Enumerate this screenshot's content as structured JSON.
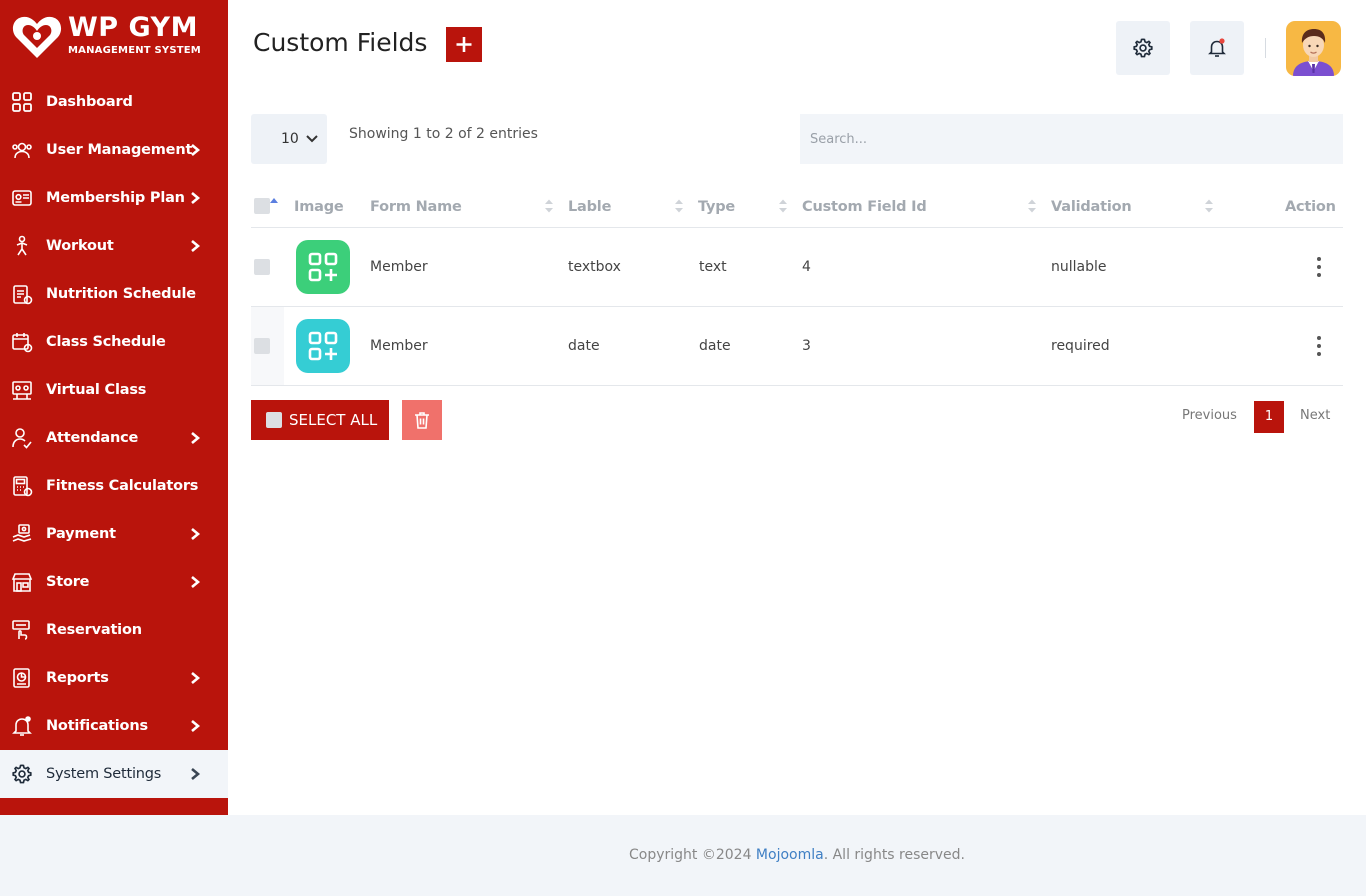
{
  "brand": {
    "title": "WP GYM",
    "subtitle": "MANAGEMENT SYSTEM",
    "color": "#b9140c"
  },
  "sidebar": {
    "items": [
      {
        "label": "Dashboard",
        "icon": "dashboard-icon",
        "has_submenu": false
      },
      {
        "label": "User Management",
        "icon": "users-icon",
        "has_submenu": true
      },
      {
        "label": "Membership Plan",
        "icon": "membership-card-icon",
        "has_submenu": true
      },
      {
        "label": "Workout",
        "icon": "workout-icon",
        "has_submenu": true
      },
      {
        "label": "Nutrition Schedule",
        "icon": "nutrition-icon",
        "has_submenu": false
      },
      {
        "label": "Class Schedule",
        "icon": "calendar-icon",
        "has_submenu": false
      },
      {
        "label": "Virtual Class",
        "icon": "virtual-class-icon",
        "has_submenu": false
      },
      {
        "label": "Attendance",
        "icon": "attendance-icon",
        "has_submenu": true
      },
      {
        "label": "Fitness Calculators",
        "icon": "calculator-icon",
        "has_submenu": false
      },
      {
        "label": "Payment",
        "icon": "payment-icon",
        "has_submenu": true
      },
      {
        "label": "Store",
        "icon": "store-icon",
        "has_submenu": true
      },
      {
        "label": "Reservation",
        "icon": "reservation-icon",
        "has_submenu": false
      },
      {
        "label": "Reports",
        "icon": "reports-icon",
        "has_submenu": true
      },
      {
        "label": "Notifications",
        "icon": "bell-icon",
        "has_submenu": true
      },
      {
        "label": "System Settings",
        "icon": "gear-icon",
        "has_submenu": true,
        "active": true
      }
    ]
  },
  "header": {
    "title": "Custom Fields",
    "add_icon": "plus-icon",
    "settings_icon": "gear-icon",
    "notification_icon": "bell-icon",
    "avatar_icon": "user-avatar"
  },
  "controls": {
    "page_length": "10",
    "info": "Showing 1 to 2 of 2 entries",
    "search_placeholder": "Search..."
  },
  "table": {
    "columns": [
      "Image",
      "Form Name",
      "Lable",
      "Type",
      "Custom Field Id",
      "Validation",
      "Action"
    ],
    "rows": [
      {
        "form_name": "Member",
        "label": "textbox",
        "type": "text",
        "id": "4",
        "validation": "nullable",
        "image_color": "#3ccf7a"
      },
      {
        "form_name": "Member",
        "label": "date",
        "type": "date",
        "id": "3",
        "validation": "required",
        "image_color": "#35cdd4"
      }
    ]
  },
  "bottom": {
    "select_all": "SELECT ALL",
    "delete_icon": "trash-icon",
    "prev": "Previous",
    "current_page": "1",
    "next": "Next"
  },
  "footer": {
    "prefix": "Copyright ©2024 ",
    "brand": "Mojoomla",
    "suffix": ". All rights reserved."
  }
}
